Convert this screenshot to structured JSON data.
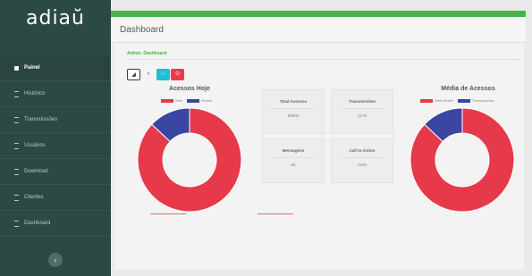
{
  "app": {
    "logo_text": "adiaŭ"
  },
  "sidebar": {
    "items": [
      {
        "label": "Painel",
        "icon": "home-icon"
      },
      {
        "label": "Histórico",
        "icon": "list-icon"
      },
      {
        "label": "Transmissões",
        "icon": "list-icon"
      },
      {
        "label": "Usuários",
        "icon": "list-icon"
      },
      {
        "label": "Download",
        "icon": "list-icon"
      },
      {
        "label": "Clientes",
        "icon": "list-icon"
      },
      {
        "label": "Dashboard",
        "icon": "list-icon"
      }
    ],
    "collapse_icon": "chevron-left-icon"
  },
  "header": {
    "title": "Dashboard"
  },
  "breadcrumb": "Admin. Dashboard",
  "toolbar": {
    "edit_icon": "edit-icon",
    "separator": "»",
    "cyan_icon": "cyan-square-icon",
    "red_icon": "red-square-icon"
  },
  "colors": {
    "sidebar": "#2c4a45",
    "accent_green": "#43b749",
    "red": "#e63a4a",
    "blue": "#3a46a2",
    "cyan": "#1ebed0"
  },
  "left_panel": {
    "title": "Acessos Hoje",
    "legend": [
      "Web",
      "Mobile"
    ]
  },
  "right_panel": {
    "title": "Média de Acessos",
    "legend": [
      "Web Mobile",
      "Transmissões"
    ]
  },
  "stats": [
    {
      "title": "Total Acessos",
      "value": "98800"
    },
    {
      "title": "Transmissões",
      "value": "3175"
    },
    {
      "title": "Mensagens",
      "value": "58"
    },
    {
      "title": "Call to Action",
      "value": "2208"
    }
  ],
  "chart_data": [
    {
      "type": "pie",
      "title": "Acessos Hoje",
      "categories": [
        "Web",
        "Mobile"
      ],
      "values": [
        87,
        13
      ],
      "colors": [
        "#e63a4a",
        "#3a46a2"
      ]
    },
    {
      "type": "pie",
      "title": "Média de Acessos",
      "categories": [
        "Web Mobile",
        "Transmissões"
      ],
      "values": [
        87,
        13
      ],
      "colors": [
        "#e63a4a",
        "#3a46a2"
      ]
    }
  ]
}
